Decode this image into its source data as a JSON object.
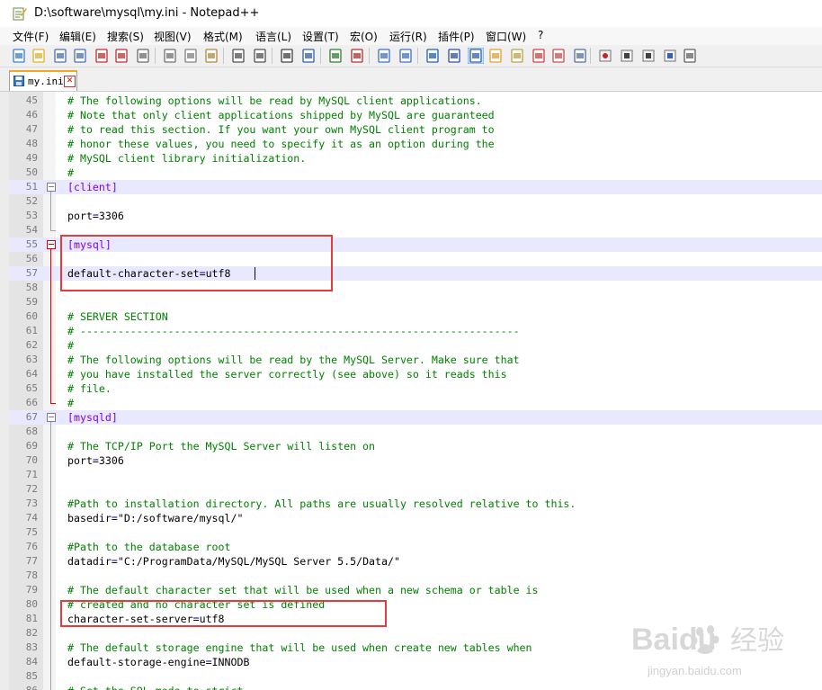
{
  "window": {
    "title": "D:\\software\\mysql\\my.ini - Notepad++"
  },
  "menu": [
    "文件(F)",
    "编辑(E)",
    "搜索(S)",
    "视图(V)",
    "格式(M)",
    "语言(L)",
    "设置(T)",
    "宏(O)",
    "运行(R)",
    "插件(P)",
    "窗口(W)",
    "?"
  ],
  "toolbar": {
    "icons": [
      "new-file-icon",
      "open-file-icon",
      "save-icon",
      "save-all-icon",
      "close-icon",
      "close-all-icon",
      "print-icon",
      "cut-icon",
      "copy-icon",
      "paste-icon",
      "undo-icon",
      "redo-icon",
      "find-icon",
      "replace-icon",
      "zoom-in-icon",
      "zoom-out-icon",
      "sync-vertical-icon",
      "sync-horizontal-icon",
      "word-wrap-icon",
      "show-all-chars-icon",
      "indent-guide-icon",
      "folder-as-workspace-icon",
      "document-map-icon",
      "function-list-icon",
      "doc-switcher-icon",
      "monitoring-icon",
      "record-macro-icon",
      "stop-record-icon",
      "play-macro-icon",
      "run-macro-multiple-icon",
      "save-macro-icon"
    ]
  },
  "tab": {
    "label": "my.ini"
  },
  "lines": [
    {
      "n": "45",
      "segs": [
        {
          "t": "# The following options will be read by MySQL client applications.",
          "c": "com"
        }
      ]
    },
    {
      "n": "46",
      "segs": [
        {
          "t": "# Note that only client applications shipped by MySQL are guaranteed",
          "c": "com"
        }
      ]
    },
    {
      "n": "47",
      "segs": [
        {
          "t": "# to read this section. If you want your own MySQL client program to",
          "c": "com"
        }
      ]
    },
    {
      "n": "48",
      "segs": [
        {
          "t": "# honor these values, you need to specify it as an option during the",
          "c": "com"
        }
      ]
    },
    {
      "n": "49",
      "segs": [
        {
          "t": "# MySQL client library initialization.",
          "c": "com"
        }
      ]
    },
    {
      "n": "50",
      "segs": [
        {
          "t": "#",
          "c": "com"
        }
      ]
    },
    {
      "n": "51",
      "segs": [
        {
          "t": "[client]",
          "c": "sec"
        }
      ]
    },
    {
      "n": "52",
      "segs": []
    },
    {
      "n": "53",
      "segs": [
        {
          "t": "port",
          "c": ""
        },
        {
          "t": "=",
          "c": "op"
        },
        {
          "t": "3306",
          "c": ""
        }
      ]
    },
    {
      "n": "54",
      "segs": []
    },
    {
      "n": "55",
      "segs": [
        {
          "t": "[mysql]",
          "c": "sec"
        }
      ]
    },
    {
      "n": "56",
      "segs": []
    },
    {
      "n": "57",
      "segs": [
        {
          "t": "default-character-set",
          "c": ""
        },
        {
          "t": "=",
          "c": "op"
        },
        {
          "t": "utf8",
          "c": ""
        }
      ]
    },
    {
      "n": "58",
      "segs": []
    },
    {
      "n": "59",
      "segs": []
    },
    {
      "n": "60",
      "segs": [
        {
          "t": "# SERVER SECTION",
          "c": "com"
        }
      ]
    },
    {
      "n": "61",
      "segs": [
        {
          "t": "# ----------------------------------------------------------------------",
          "c": "com"
        }
      ]
    },
    {
      "n": "62",
      "segs": [
        {
          "t": "#",
          "c": "com"
        }
      ]
    },
    {
      "n": "63",
      "segs": [
        {
          "t": "# The following options will be read by the MySQL Server. Make sure that",
          "c": "com"
        }
      ]
    },
    {
      "n": "64",
      "segs": [
        {
          "t": "# you have installed the server correctly (see above) so it reads this",
          "c": "com"
        }
      ]
    },
    {
      "n": "65",
      "segs": [
        {
          "t": "# file.",
          "c": "com"
        }
      ]
    },
    {
      "n": "66",
      "segs": [
        {
          "t": "#",
          "c": "com"
        }
      ]
    },
    {
      "n": "67",
      "segs": [
        {
          "t": "[mysqld]",
          "c": "sec"
        }
      ]
    },
    {
      "n": "68",
      "segs": []
    },
    {
      "n": "69",
      "segs": [
        {
          "t": "# The TCP/IP Port the MySQL Server will listen on",
          "c": "com"
        }
      ]
    },
    {
      "n": "70",
      "segs": [
        {
          "t": "port",
          "c": ""
        },
        {
          "t": "=",
          "c": "op"
        },
        {
          "t": "3306",
          "c": ""
        }
      ]
    },
    {
      "n": "71",
      "segs": []
    },
    {
      "n": "72",
      "segs": []
    },
    {
      "n": "73",
      "segs": [
        {
          "t": "#Path to installation directory. All paths are usually resolved relative to this.",
          "c": "com"
        }
      ]
    },
    {
      "n": "74",
      "segs": [
        {
          "t": "basedir",
          "c": ""
        },
        {
          "t": "=",
          "c": "op"
        },
        {
          "t": "\"D:/software/mysql/\"",
          "c": ""
        }
      ]
    },
    {
      "n": "75",
      "segs": []
    },
    {
      "n": "76",
      "segs": [
        {
          "t": "#Path to the database root",
          "c": "com"
        }
      ]
    },
    {
      "n": "77",
      "segs": [
        {
          "t": "datadir",
          "c": ""
        },
        {
          "t": "=",
          "c": "op"
        },
        {
          "t": "\"C:/ProgramData/MySQL/MySQL Server 5.5/Data/\"",
          "c": ""
        }
      ]
    },
    {
      "n": "78",
      "segs": []
    },
    {
      "n": "79",
      "segs": [
        {
          "t": "# The default character set that will be used when a new schema or table is",
          "c": "com"
        }
      ]
    },
    {
      "n": "80",
      "segs": [
        {
          "t": "# created and no character set is defined",
          "c": "com"
        }
      ]
    },
    {
      "n": "81",
      "segs": [
        {
          "t": "character-set-server",
          "c": ""
        },
        {
          "t": "=",
          "c": "op"
        },
        {
          "t": "utf8",
          "c": ""
        }
      ]
    },
    {
      "n": "82",
      "segs": []
    },
    {
      "n": "83",
      "segs": [
        {
          "t": "# The default storage engine that will be used when create new tables when",
          "c": "com"
        }
      ]
    },
    {
      "n": "84",
      "segs": [
        {
          "t": "default-storage-engine",
          "c": ""
        },
        {
          "t": "=",
          "c": "op"
        },
        {
          "t": "INNODB",
          "c": ""
        }
      ]
    },
    {
      "n": "85",
      "segs": []
    },
    {
      "n": "86",
      "segs": [
        {
          "t": "# Set the SQL mode to strict",
          "c": "com"
        }
      ]
    }
  ],
  "watermark": {
    "brand": "Baidu",
    "cn": "经验",
    "url": "jingyan.baidu.com"
  },
  "colors": {
    "comment": "#008000",
    "section": "#8000ff",
    "operator": "#000080",
    "annotation": "#e8393b",
    "current_line": "#e8e8ff"
  }
}
